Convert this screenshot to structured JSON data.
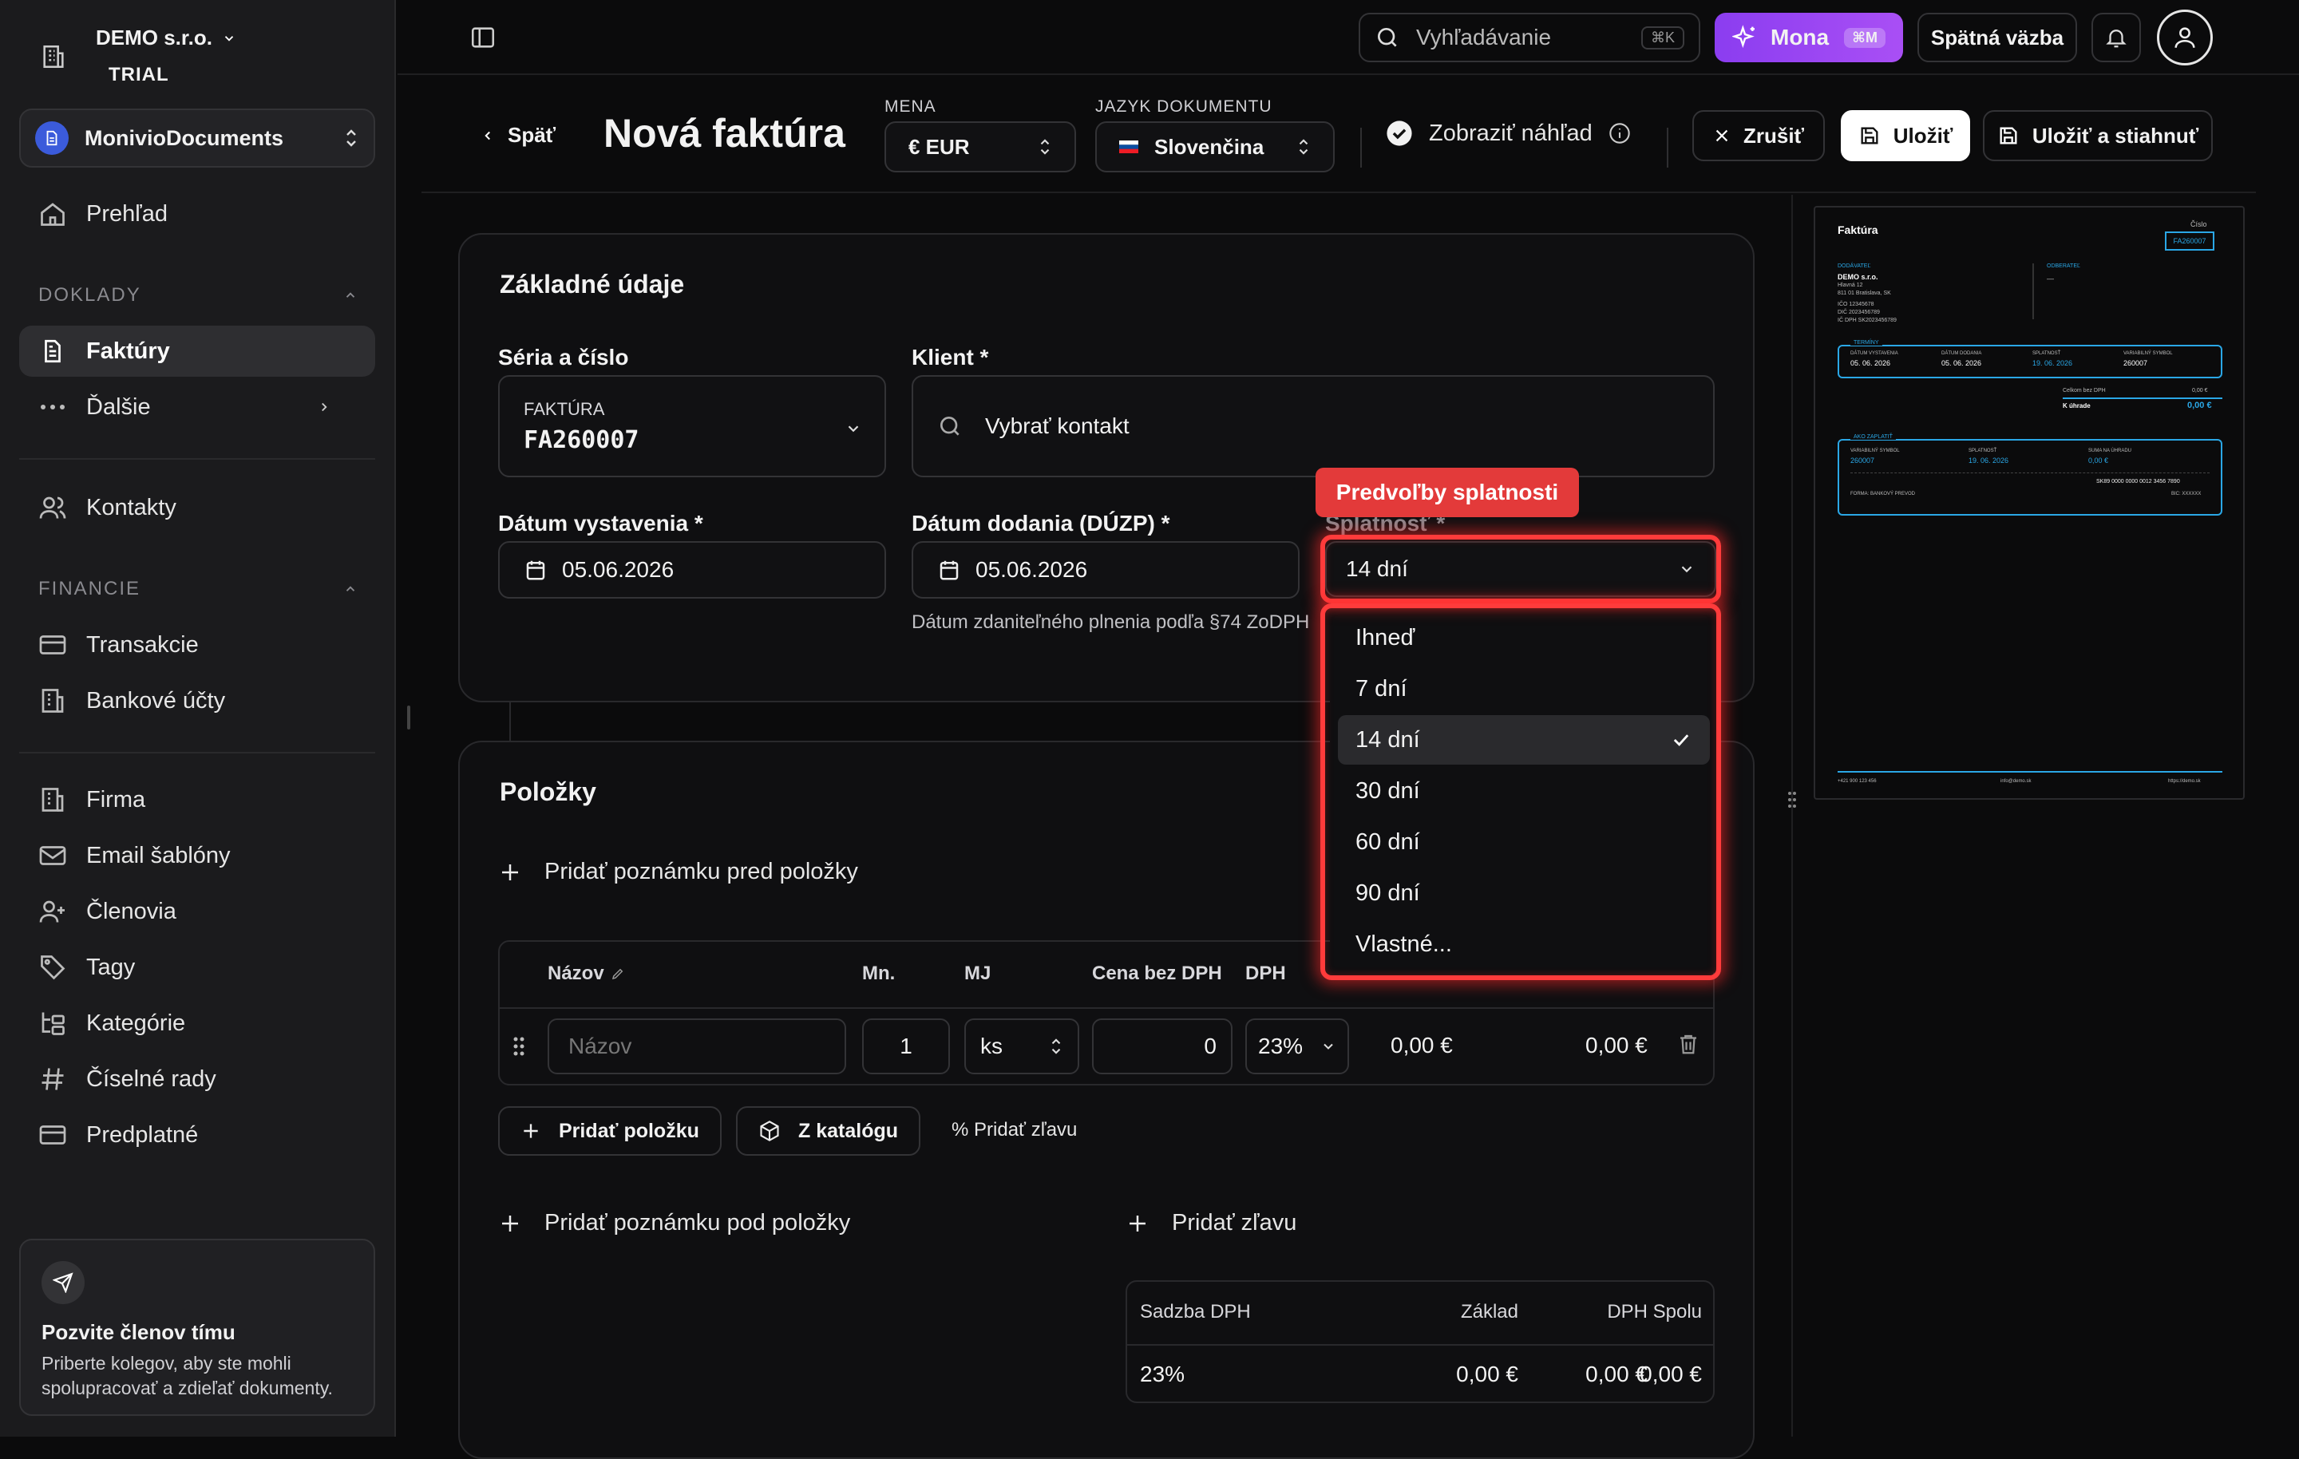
{
  "sidebar": {
    "org_name": "DEMO s.r.o.",
    "org_plan": "TRIAL",
    "workspace": "MonivioDocuments",
    "overview": "Prehľad",
    "section_docs": "DOKLADY",
    "invoices": "Faktúry",
    "more": "Ďalšie",
    "contacts": "Kontakty",
    "section_finance": "FINANCIE",
    "transactions": "Transakcie",
    "bank_accounts": "Bankové účty",
    "company": "Firma",
    "email_templates": "Email šablóny",
    "members": "Členovia",
    "tags": "Tagy",
    "categories": "Kategórie",
    "number_series": "Číselné rady",
    "subscription": "Predplatné",
    "invite_title": "Pozvite členov tímu",
    "invite_text": "Priberte kolegov, aby ste mohli spolupracovať a zdieľať dokumenty."
  },
  "topbar": {
    "search_placeholder": "Vyhľadávanie",
    "search_kbd": "⌘K",
    "mona_label": "Mona",
    "mona_kbd": "⌘M",
    "feedback": "Spätná väzba"
  },
  "header": {
    "back": "Späť",
    "title": "Nová faktúra",
    "currency_label": "MENA",
    "currency_value": "€ EUR",
    "language_label": "JAZYK DOKUMENTU",
    "language_value": "Slovenčina",
    "show_preview": "Zobraziť náhľad",
    "cancel": "Zrušiť",
    "save": "Uložiť",
    "save_download": "Uložiť a stiahnuť"
  },
  "basic": {
    "title": "Základné údaje",
    "series_label": "Séria a číslo",
    "series_type": "FAKTÚRA",
    "series_number": "FA260007",
    "client_label": "Klient *",
    "client_placeholder": "Vybrať kontakt",
    "issue_label": "Dátum vystavenia *",
    "issue_value": "05.06.2026",
    "delivery_label": "Dátum dodania (DÚZP) *",
    "delivery_value": "05.06.2026",
    "delivery_hint": "Dátum zdaniteľného plnenia podľa §74 ZoDPH",
    "due_label": "Splatnosť *",
    "due_value": "14 dní"
  },
  "due_dropdown": {
    "tooltip": "Predvoľby splatnosti",
    "options": [
      "Ihneď",
      "7 dní",
      "14 dní",
      "30 dní",
      "60 dní",
      "90 dní",
      "Vlastné..."
    ],
    "selected": "14 dní"
  },
  "items": {
    "title": "Položky",
    "add_note_before": "Pridať poznámku pred položky",
    "col_name": "Názov",
    "col_qty": "Mn.",
    "col_unit": "MJ",
    "col_price": "Cena bez DPH",
    "col_vat": "DPH",
    "row_name_placeholder": "Názov",
    "row_qty": "1",
    "row_unit": "ks",
    "row_price": "0",
    "row_vat": "23%",
    "row_vat_amount": "0,00 €",
    "row_total": "0,00 €",
    "add_item": "Pridať položku",
    "from_catalog": "Z katalógu",
    "add_discount_small": "% Pridať zľavu",
    "add_note_after": "Pridať poznámku pod položky",
    "add_discount": "Pridať zľavu"
  },
  "vat_summary": {
    "headers": [
      "Sadzba DPH",
      "Základ",
      "DPH",
      "Spolu"
    ],
    "row": [
      "23%",
      "0,00 €",
      "0,00 €",
      "0,00 €"
    ]
  },
  "preview": {
    "title": "Faktúra",
    "number_label": "Číslo",
    "number": "FA260007",
    "supplier_label": "DODÁVATEĽ",
    "supplier_name": "DEMO s.r.o.",
    "supplier_street": "Hlavná 12",
    "supplier_city": "811 01 Bratislava, SK",
    "ico": "IČO 12345678",
    "dic": "DIČ 2023456789",
    "icdph": "IČ DPH SK2023456789",
    "customer_label": "ODBERATEĽ",
    "customer_value": "—",
    "terms_label": "TERMÍNY",
    "t_issue_label": "DÁTUM VYSTAVENIA",
    "t_issue": "05. 06. 2026",
    "t_delivery_label": "DÁTUM DODANIA",
    "t_delivery": "05. 06. 2026",
    "t_due_label": "SPLATNOSŤ",
    "t_due": "19. 06. 2026",
    "t_vs_label": "VARIABILNÝ SYMBOL",
    "t_vs": "260007",
    "sum_label": "Celkom bez DPH",
    "sum_value": "0,00 €",
    "topay_label": "K úhrade",
    "topay_value": "0,00 €",
    "pay_label": "AKO ZAPLATIŤ",
    "p_vs_label": "VARIABILNÝ SYMBOL",
    "p_vs": "260007",
    "p_due_label": "SPLATNOSŤ",
    "p_due": "19. 06. 2026",
    "p_sum_label": "SUMA NA ÚHRADU",
    "p_sum": "0,00 €",
    "iban": "SK89 0000 0000 0012 3456 7890",
    "form": "FORMA: BANKOVÝ PREVOD",
    "swift": "BIC: XXXXXX",
    "phone": "+421 900 123 456",
    "email": "info@demo.sk",
    "web": "https://demo.sk"
  }
}
